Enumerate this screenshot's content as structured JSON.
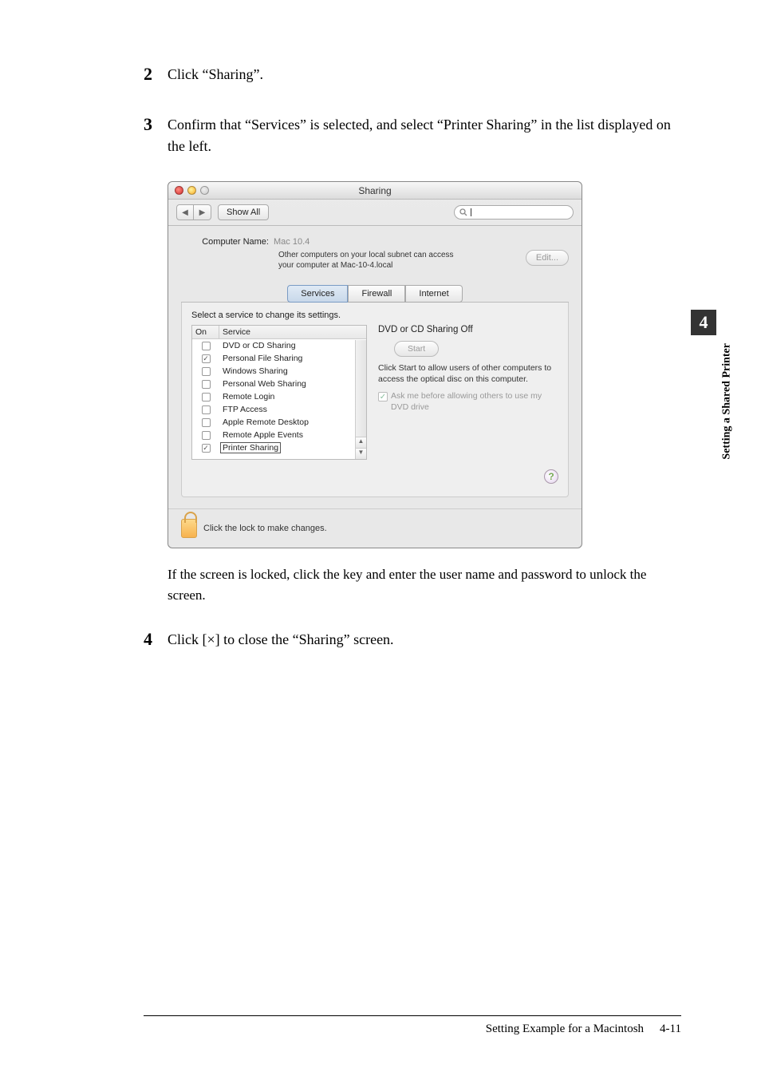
{
  "steps": {
    "s2": {
      "num": "2",
      "text": "Click “Sharing”."
    },
    "s3": {
      "num": "3",
      "text": "Confirm that “Services” is selected, and select “Printer Sharing” in the list displayed on the left."
    },
    "s3_sub": "If the screen is locked, click the key and enter the user name and password to unlock the screen.",
    "s4": {
      "num": "4",
      "text": "Click [×] to close the “Sharing” screen."
    }
  },
  "window": {
    "title": "Sharing",
    "show_all": "Show All",
    "search_placeholder": "",
    "computer_name_label": "Computer Name:",
    "computer_name_value": "Mac 10.4",
    "info_text1": "Other computers on your local subnet can access",
    "info_text2": "your computer at Mac-10-4.local",
    "edit_label": "Edit...",
    "tabs": {
      "services": "Services",
      "firewall": "Firewall",
      "internet": "Internet"
    },
    "select_label": "Select a service to change its settings.",
    "cols": {
      "on": "On",
      "service": "Service"
    },
    "services": [
      {
        "on": false,
        "name": "DVD or CD Sharing"
      },
      {
        "on": true,
        "name": "Personal File Sharing"
      },
      {
        "on": false,
        "name": "Windows Sharing"
      },
      {
        "on": false,
        "name": "Personal Web Sharing"
      },
      {
        "on": false,
        "name": "Remote Login"
      },
      {
        "on": false,
        "name": "FTP Access"
      },
      {
        "on": false,
        "name": "Apple Remote Desktop"
      },
      {
        "on": false,
        "name": "Remote Apple Events"
      },
      {
        "on": true,
        "name": "Printer Sharing",
        "boxed": true
      }
    ],
    "right": {
      "title": "DVD or CD Sharing Off",
      "start": "Start",
      "desc": "Click Start to allow users of other computers to access the optical disc on this computer.",
      "ask_label": "Ask me before allowing others to use my DVD drive"
    },
    "help": "?",
    "lock_text": "Click the lock to make changes."
  },
  "side": {
    "chapter_num": "4",
    "chapter_label": "Setting a Shared Printer"
  },
  "footer": {
    "section": "Setting Example for a Macintosh",
    "page": "4-11"
  }
}
